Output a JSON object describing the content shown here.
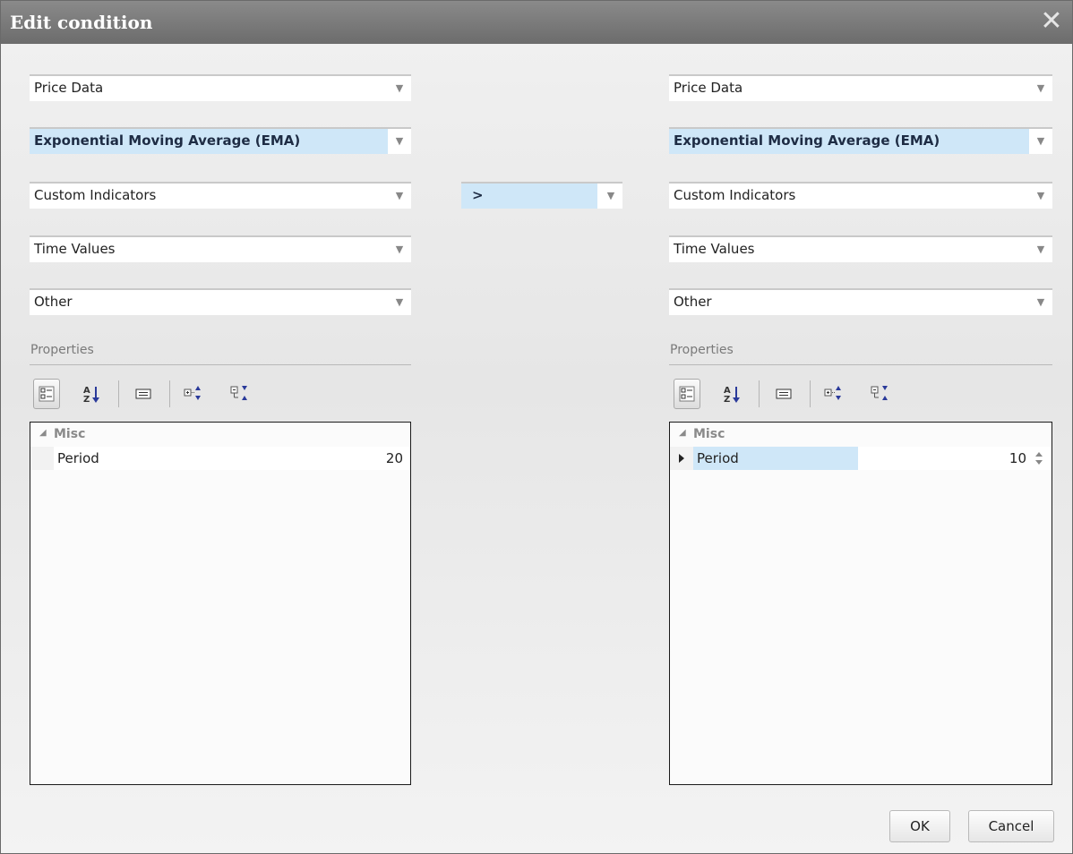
{
  "dialog": {
    "title": "Edit condition",
    "close_glyph": "✕"
  },
  "left": {
    "combos": [
      {
        "label": "Price Data",
        "selected": false
      },
      {
        "label": "Exponential Moving Average (EMA)",
        "selected": true
      },
      {
        "label": "Custom Indicators",
        "selected": false
      },
      {
        "label": "Time Values",
        "selected": false
      },
      {
        "label": "Other",
        "selected": false
      }
    ],
    "properties": {
      "title": "Properties",
      "category": "Misc",
      "rows": [
        {
          "name": "Period",
          "value": "20"
        }
      ]
    }
  },
  "operator": {
    "label": ">"
  },
  "right": {
    "combos": [
      {
        "label": "Price Data",
        "selected": false
      },
      {
        "label": "Exponential Moving Average (EMA)",
        "selected": true
      },
      {
        "label": "Custom Indicators",
        "selected": false
      },
      {
        "label": "Time Values",
        "selected": false
      },
      {
        "label": "Other",
        "selected": false
      }
    ],
    "properties": {
      "title": "Properties",
      "category": "Misc",
      "rows": [
        {
          "name": "Period",
          "value": "10"
        }
      ]
    }
  },
  "toolbar_icons": [
    "categorized-icon",
    "alphabetical-sort-icon",
    "property-pages-icon",
    "expand-all-icon",
    "collapse-all-icon"
  ],
  "buttons": {
    "ok": "OK",
    "cancel": "Cancel"
  },
  "colors": {
    "title_bar": "#767676",
    "selection": "#cfe7f8",
    "dialog_bg": "#ececec"
  }
}
